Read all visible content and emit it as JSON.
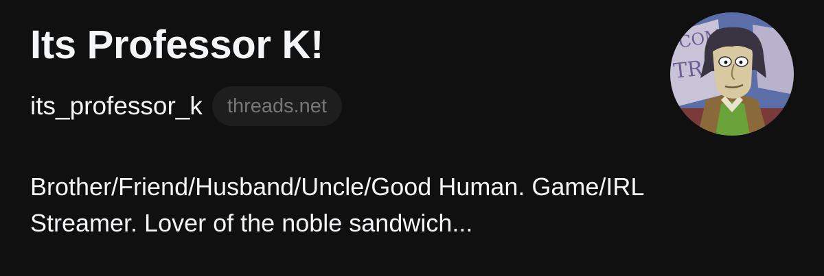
{
  "profile": {
    "display_name": "Its Professor K!",
    "username": "its_professor_k",
    "domain_badge": "threads.net",
    "bio_line1": "Brother/Friend/Husband/Uncle/Good Human. Game/IRL",
    "bio_line2": "Streamer. Lover of the noble sandwich..."
  },
  "avatar": {
    "icon": "cartoon-character-avatar",
    "banner_lettering": "COMING TR",
    "colors": {
      "sky": "#5b6ea8",
      "banner": "#c9c3d8",
      "jacket": "#8a6a3a",
      "sweater": "#6aa33a",
      "skin": "#d8c9a0",
      "hair": "#3a3442"
    }
  },
  "theme": {
    "background": "#101010",
    "text": "#f3f5f7",
    "muted": "#777777",
    "badge_bg": "#1e1e1e"
  }
}
